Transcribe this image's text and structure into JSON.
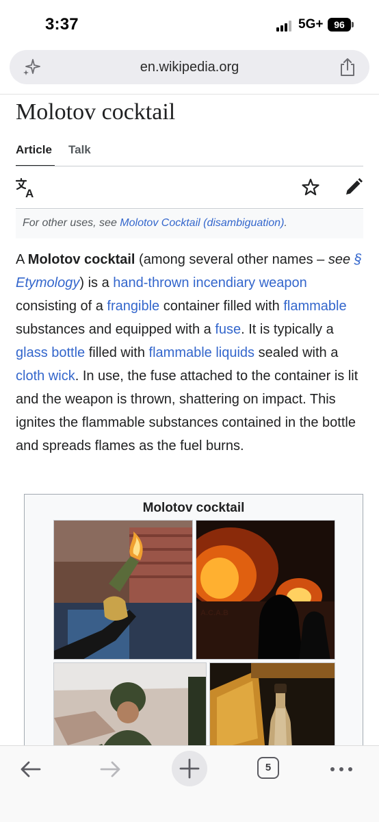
{
  "status_bar": {
    "time": "3:37",
    "network": "5G+",
    "battery": "96"
  },
  "browser": {
    "url": "en.wikipedia.org",
    "open_tab_count": "5"
  },
  "article": {
    "title": "Molotov cocktail",
    "tabs": [
      {
        "label": "Article",
        "active": true
      },
      {
        "label": "Talk",
        "active": false
      }
    ],
    "hatnote": {
      "prefix": "For other uses, see ",
      "link": "Molotov Cocktail (disambiguation)",
      "suffix": "."
    },
    "intro": [
      {
        "type": "text",
        "text": "A "
      },
      {
        "type": "bold",
        "text": "Molotov cocktail"
      },
      {
        "type": "text",
        "text": " (among several other names – "
      },
      {
        "type": "italic",
        "text": "see "
      },
      {
        "type": "italic-link",
        "text": "§ Etymology"
      },
      {
        "type": "text",
        "text": ") is a "
      },
      {
        "type": "link",
        "text": "hand-thrown incendiary weapon"
      },
      {
        "type": "text",
        "text": " consisting of a "
      },
      {
        "type": "link",
        "text": "frangible"
      },
      {
        "type": "text",
        "text": " container filled with "
      },
      {
        "type": "link",
        "text": "flammable"
      },
      {
        "type": "text",
        "text": " substances and equipped with a "
      },
      {
        "type": "link",
        "text": "fuse"
      },
      {
        "type": "text",
        "text": ". It is typically a "
      },
      {
        "type": "link",
        "text": "glass bottle"
      },
      {
        "type": "text",
        "text": " filled with "
      },
      {
        "type": "link",
        "text": "flammable liquids"
      },
      {
        "type": "text",
        "text": " sealed with a "
      },
      {
        "type": "link",
        "text": "cloth wick"
      },
      {
        "type": "text",
        "text": ". In use, the fuse attached to the container is lit and the weapon is thrown, shattering on impact. This ignites the flammable substances contained in the bottle and spreads flames as the fuel burns."
      }
    ],
    "infobox": {
      "title": "Molotov cocktail"
    }
  },
  "colors": {
    "link": "#3366cc",
    "text": "#202122",
    "muted": "#54595d"
  }
}
